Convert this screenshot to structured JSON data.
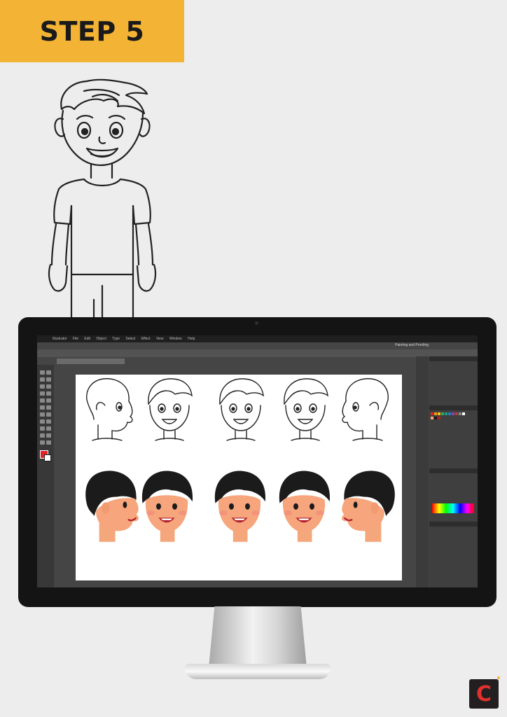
{
  "banner": {
    "step_label": "STEP 5",
    "color": "#f3b334"
  },
  "illustration": {
    "sketch": "pencil-sketch-boy-icon"
  },
  "screen": {
    "app_name": "Illustrator",
    "menu_items": [
      "File",
      "Edit",
      "Object",
      "Type",
      "Select",
      "Effect",
      "View",
      "Window",
      "Help"
    ],
    "workspace": "Painting and Proofing"
  },
  "logo": {
    "letter": "C",
    "color": "#e2312d"
  }
}
